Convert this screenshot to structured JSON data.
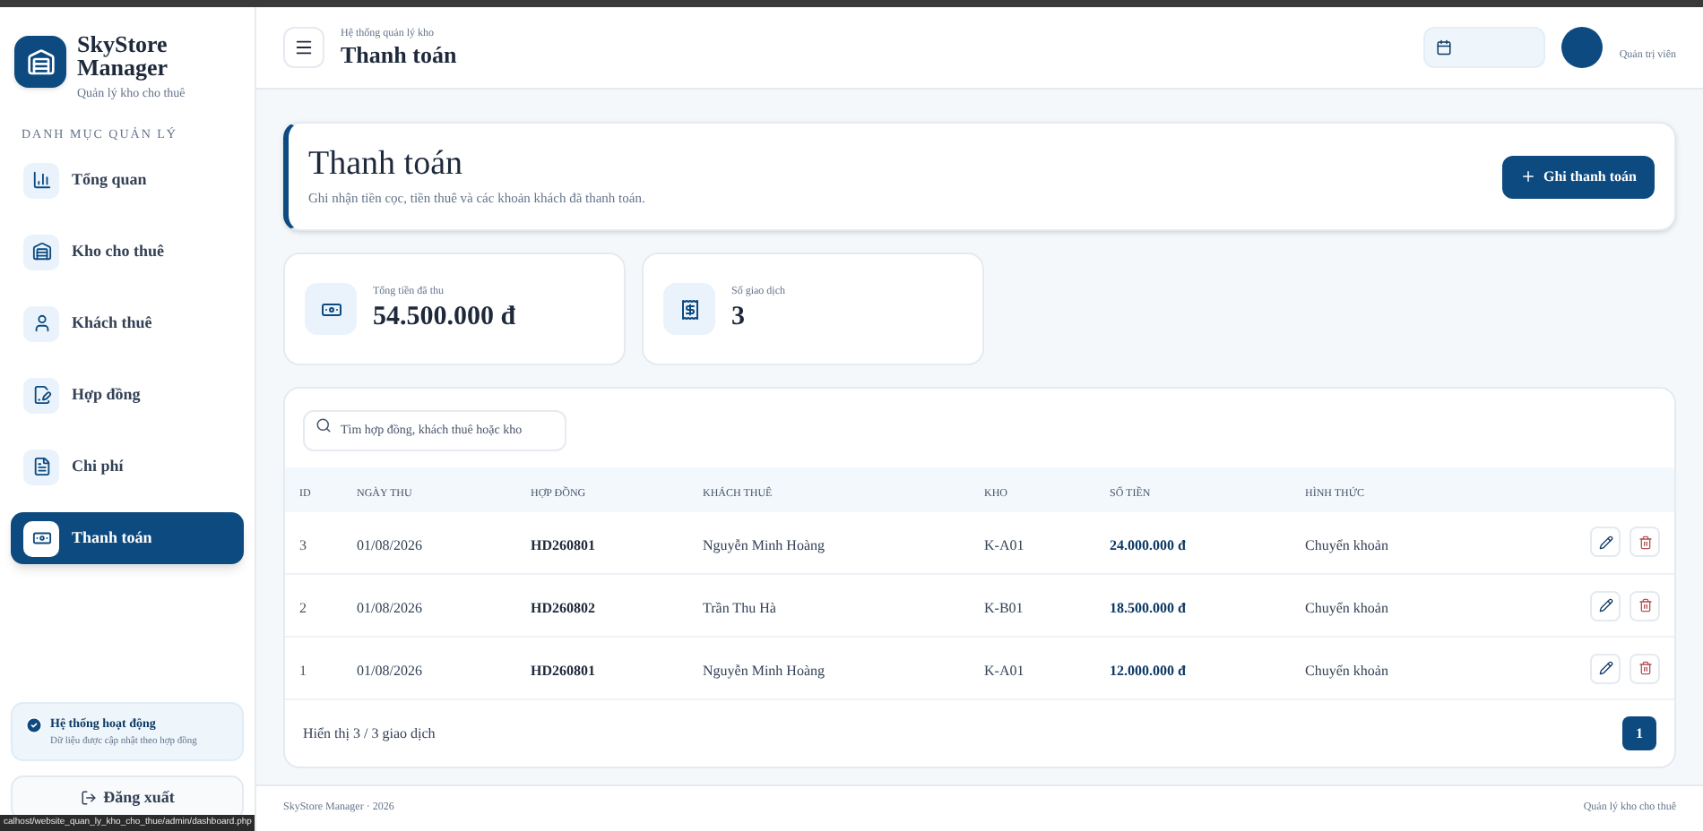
{
  "sidebar": {
    "brand": "SkyStore Manager",
    "tagline": "Quản lý kho cho thuê",
    "section": "DANH MỤC QUẢN LÝ",
    "items": [
      {
        "label": "Tổng quan",
        "selected": false
      },
      {
        "label": "Kho cho thuê",
        "selected": false
      },
      {
        "label": "Khách thuê",
        "selected": false
      },
      {
        "label": "Hợp đồng",
        "selected": false
      },
      {
        "label": "Chi phí",
        "selected": false
      },
      {
        "label": "Thanh toán",
        "selected": true
      }
    ],
    "status": {
      "title": "Hệ thống hoạt động",
      "note": "Dữ liệu được cập nhật theo hợp đồng"
    },
    "logout": "Đăng xuất"
  },
  "header": {
    "breadcrumb": "Hệ thống quản lý kho",
    "title": "Thanh toán",
    "role": "Quản trị viên"
  },
  "page": {
    "title": "Thanh toán",
    "subtitle": "Ghi nhận tiền cọc, tiền thuê và các khoản khách đã thanh toán.",
    "action": "Ghi thanh toán"
  },
  "stats": [
    {
      "label": "Tổng tiền đã thu",
      "value": "54.500.000 đ"
    },
    {
      "label": "Số giao dịch",
      "value": "3"
    }
  ],
  "search": {
    "placeholder": "Tìm hợp đồng, khách thuê hoặc kho"
  },
  "table": {
    "columns": [
      "ID",
      "NGÀY THU",
      "HỢP ĐỒNG",
      "KHÁCH THUÊ",
      "KHO",
      "SỐ TIỀN",
      "HÌNH THỨC"
    ],
    "rows": [
      [
        "3",
        "01/08/2026",
        "HD260801",
        "Nguyễn Minh Hoàng",
        "K-A01",
        "24.000.000 đ",
        "Chuyển khoản"
      ],
      [
        "2",
        "01/08/2026",
        "HD260802",
        "Trần Thu Hà",
        "K-B01",
        "18.500.000 đ",
        "Chuyển khoản"
      ],
      [
        "1",
        "01/08/2026",
        "HD260801",
        "Nguyễn Minh Hoàng",
        "K-A01",
        "12.000.000 đ",
        "Chuyển khoản"
      ]
    ],
    "summary": "Hiển thị 3 / 3 giao dịch",
    "pages": [
      {
        "label": "1",
        "selected": true
      }
    ]
  },
  "footer": {
    "left": "SkyStore Manager · 2026",
    "right": "Quản lý kho cho thuê"
  },
  "status_url": "calhost/website_quan_ly_kho_cho_thue/admin/dashboard.php"
}
